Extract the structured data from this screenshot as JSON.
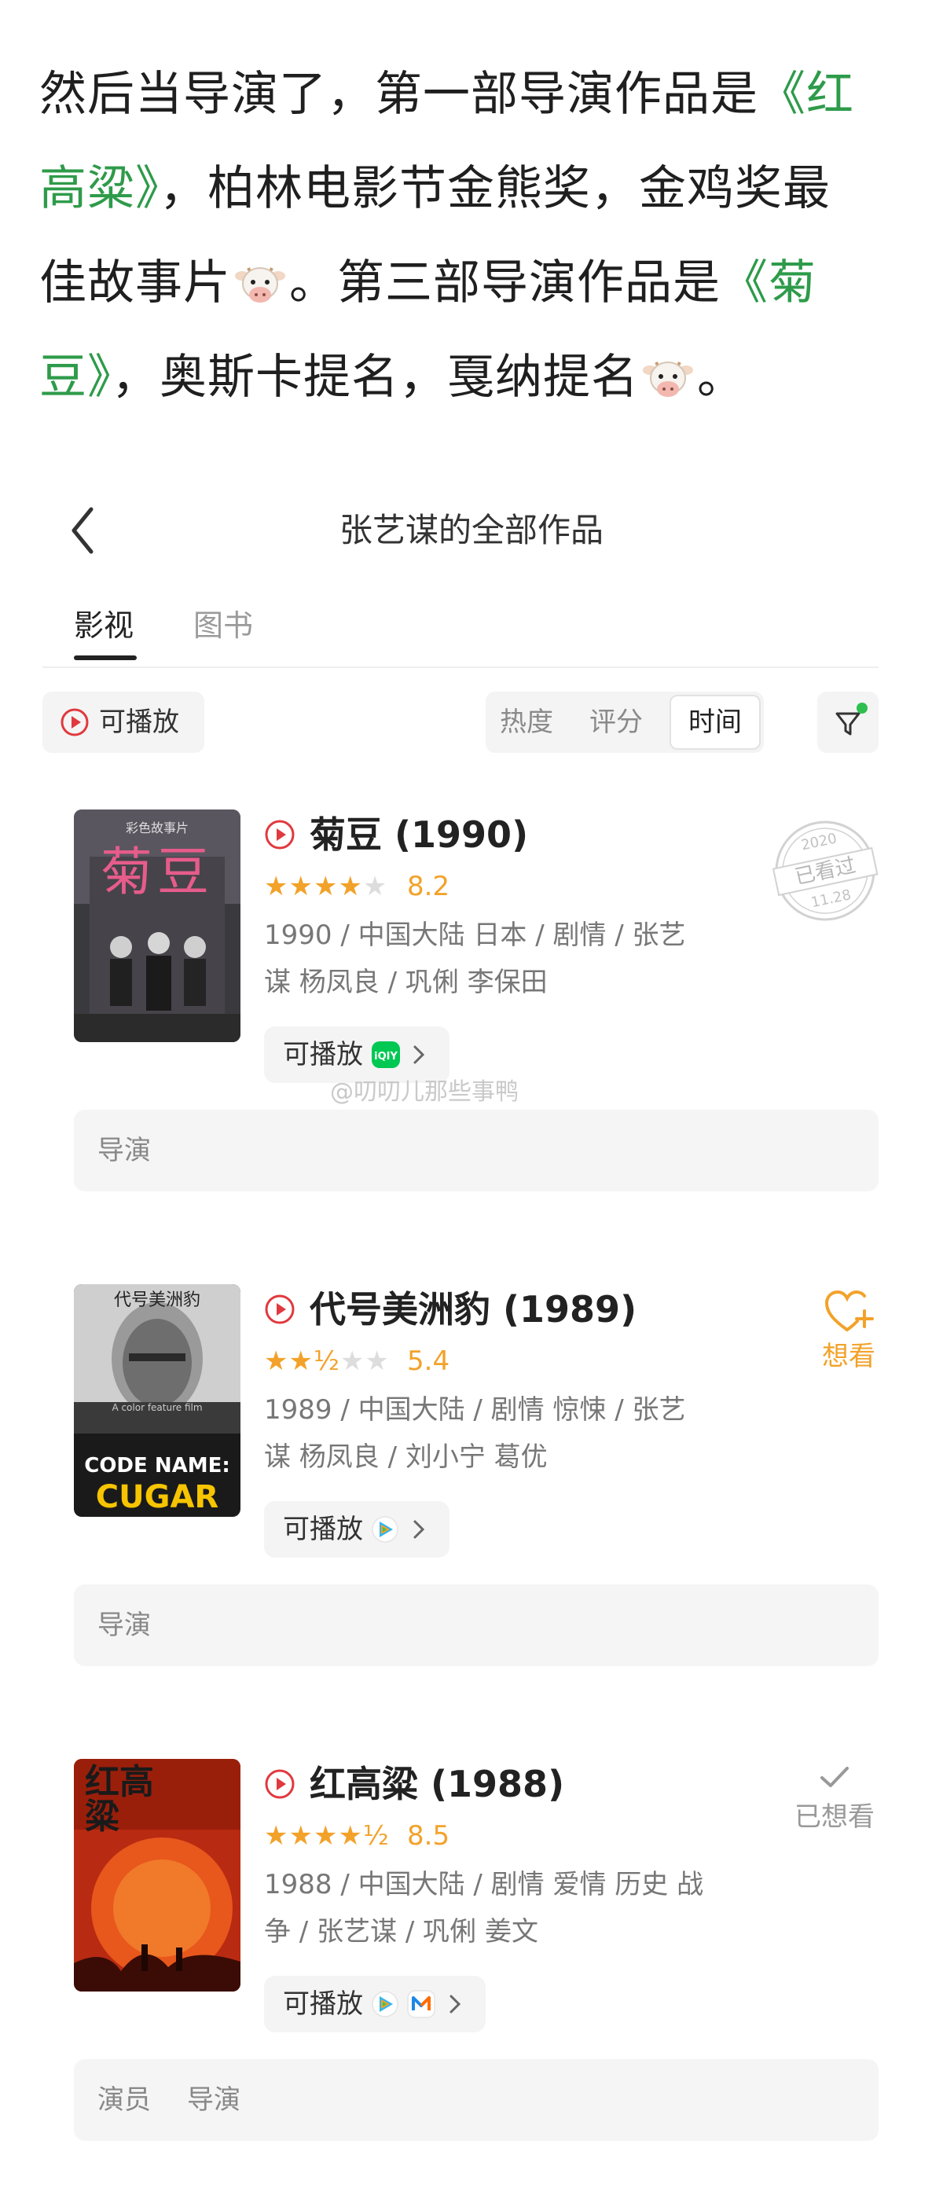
{
  "intro": {
    "l1_a": "然后当导演了，第一部导演作品是",
    "l1_b": "《红",
    "l2_a": "高粱》",
    "l2_b": "，柏林电影节金熊奖，金鸡奖最",
    "l3_a": "佳故事片",
    "l3_b": "。第三部导演作品是",
    "l3_c": "《菊",
    "l4_a": "豆》",
    "l4_b": "，奥斯卡提名，戛纳提名",
    "l4_c": "。"
  },
  "header": {
    "title": "张艺谋的全部作品"
  },
  "tabs": [
    "影视",
    "图书"
  ],
  "filters": {
    "playable": "可播放",
    "sort": [
      "热度",
      "评分",
      "时间"
    ],
    "sort_selected": "时间"
  },
  "movies": [
    {
      "title": "菊豆 (1990)",
      "stars": "★★★★",
      "stars_off": "★",
      "rating": "8.2",
      "rating_value": 8.2,
      "meta_l1": "1990 / 中国大陆 日本 / 剧情 / 张艺",
      "meta_l2": "谋 杨凤良 / 巩俐 李保田",
      "play_label": "可播放",
      "platforms": [
        "iqiyi"
      ],
      "roles": [
        "导演"
      ],
      "stamp": {
        "year": "2020",
        "text": "已看过",
        "date": "11.28"
      },
      "poster_caption": "彩色故事片",
      "poster_title": "菊豆"
    },
    {
      "title": "代号美洲豹 (1989)",
      "stars": "★★½",
      "stars_off": "★★",
      "rating": "5.4",
      "rating_value": 5.4,
      "meta_l1": "1989 / 中国大陆 / 剧情 惊悚 / 张艺",
      "meta_l2": "谋 杨凤良 / 刘小宁 葛优",
      "play_label": "可播放",
      "platforms": [
        "tencent-video"
      ],
      "roles": [
        "导演"
      ],
      "action": "想看",
      "poster_top": "代号美洲豹",
      "poster_line1": "CODE NAME:",
      "poster_line2": "CUGAR",
      "poster_small": "A color feature film"
    },
    {
      "title": "红高粱 (1988)",
      "stars": "★★★★½",
      "stars_off": "",
      "rating": "8.5",
      "rating_value": 8.5,
      "meta_l1": "1988 / 中国大陆 / 剧情 爱情 历史 战",
      "meta_l2": "争 / 张艺谋 / 巩俐 姜文",
      "play_label": "可播放",
      "platforms": [
        "tencent-video",
        "mgtv"
      ],
      "roles": [
        "演员",
        "导演"
      ],
      "action": "已想看",
      "poster_title": "红高粱"
    }
  ],
  "watermark": "@叨叨儿那些事鸭",
  "colors": {
    "accent_green": "#2e9b4a",
    "star": "#f2a22a",
    "play_red": "#e0393e"
  }
}
